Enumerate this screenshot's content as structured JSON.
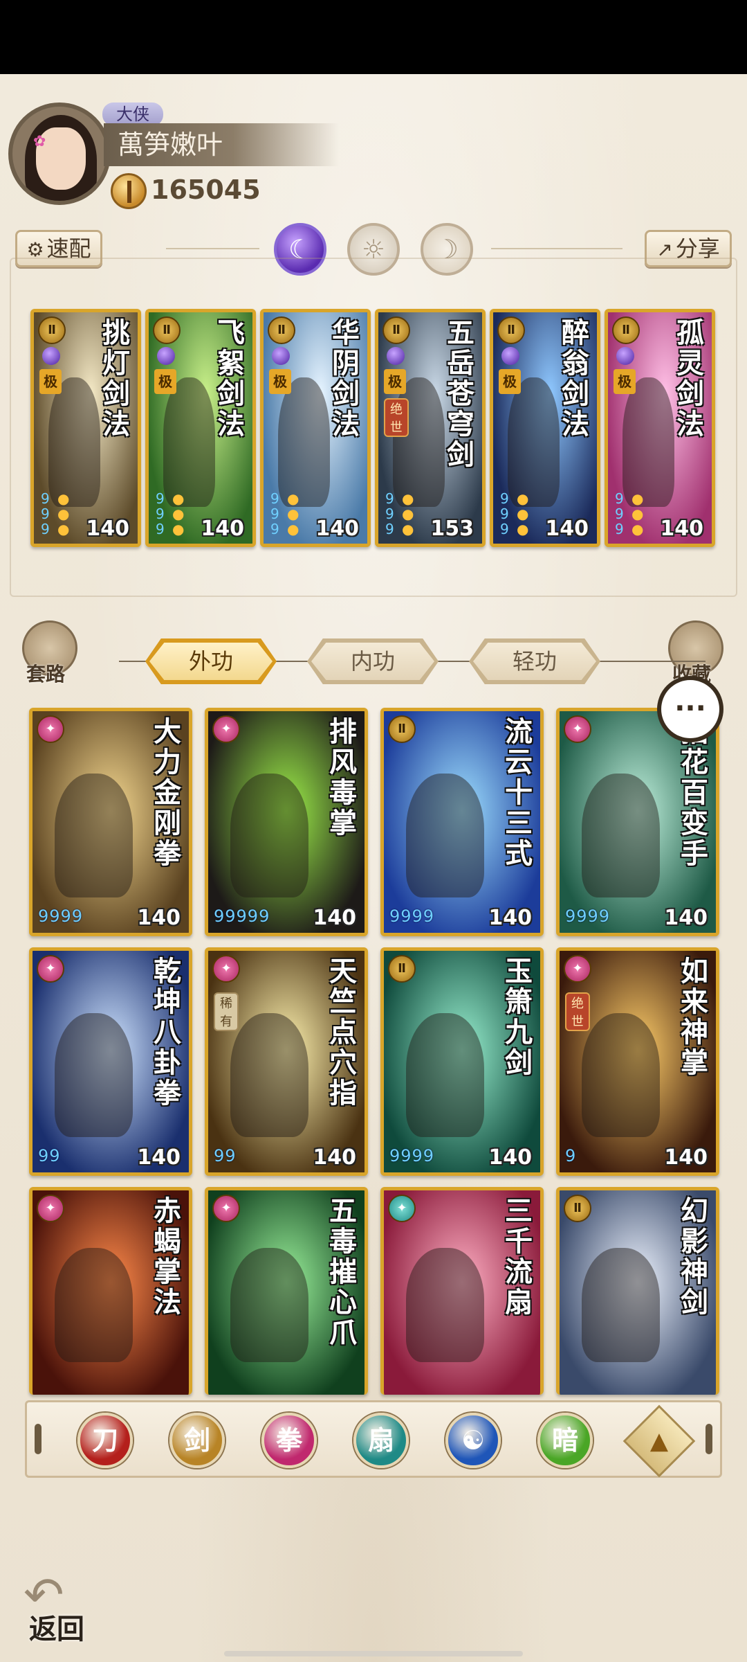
{
  "player": {
    "title": "大侠",
    "name": "萬笋嫩叶",
    "coins": "165045"
  },
  "toolbar": {
    "quick_config_label": "速配",
    "share_label": "分享",
    "gear_icon": "⚙",
    "share_icon": "↗"
  },
  "loadout": [
    {
      "title": "挑灯剑法",
      "tag": "极",
      "value": "140",
      "color_a": "#f4e9c6",
      "color_b": "#5d4b2a"
    },
    {
      "title": "飞絮剑法",
      "tag": "极",
      "value": "140",
      "color_a": "#c9f08a",
      "color_b": "#2f6a24"
    },
    {
      "title": "华阴剑法",
      "tag": "极",
      "value": "140",
      "color_a": "#e6f4ff",
      "color_b": "#4a7aa8"
    },
    {
      "title": "五岳苍穹剑",
      "tag": "极",
      "tag2": "绝世",
      "value": "153",
      "color_a": "#c9d8e6",
      "color_b": "#2c3a4a"
    },
    {
      "title": "醉翁剑法",
      "tag": "极",
      "value": "140",
      "color_a": "#8fc8ff",
      "color_b": "#1b2a5a"
    },
    {
      "title": "孤灵剑法",
      "tag": "极",
      "value": "140",
      "color_a": "#ffc0e6",
      "color_b": "#a0306e"
    }
  ],
  "tabs": {
    "left_label": "套路",
    "right_label": "收藏",
    "items": [
      "外功",
      "内功",
      "轻功"
    ],
    "active_index": 0
  },
  "skills": [
    {
      "title": "大力金刚拳",
      "pips": "9999",
      "value": "140",
      "rank": "pink",
      "color_a": "#f5d890",
      "color_b": "#5a4220"
    },
    {
      "title": "排风毒掌",
      "pips": "99999",
      "value": "140",
      "rank": "pink",
      "color_a": "#9ef04a",
      "color_b": "#1d1a18"
    },
    {
      "title": "流云十三式",
      "pips": "9999",
      "value": "140",
      "rank": "gold",
      "color_a": "#9fe0ff",
      "color_b": "#1c3c9a"
    },
    {
      "title": "拈花百变手",
      "pips": "9999",
      "value": "140",
      "rank": "pink",
      "color_a": "#bff0dc",
      "color_b": "#1e5a46"
    },
    {
      "title": "乾坤八卦拳",
      "pips": "99",
      "value": "140",
      "rank": "pink",
      "color_a": "#cfe4ff",
      "color_b": "#1a2f6e"
    },
    {
      "title": "天竺点穴指",
      "pips": "99",
      "value": "140",
      "rank": "pink",
      "tag3": "稀有",
      "color_a": "#fff3b0",
      "color_b": "#4a3212"
    },
    {
      "title": "玉箫九剑",
      "pips": "9999",
      "value": "140",
      "rank": "gold",
      "color_a": "#9af0d0",
      "color_b": "#0f4a3c"
    },
    {
      "title": "如来神掌",
      "pips": "9",
      "value": "140",
      "rank": "pink",
      "tag2": "绝世",
      "color_a": "#ffce6a",
      "color_b": "#3a1a0c"
    },
    {
      "title": "赤蝎掌法",
      "pips": "",
      "value": "",
      "rank": "pink",
      "color_a": "#ff8a4a",
      "color_b": "#4a120a"
    },
    {
      "title": "五毒摧心爪",
      "pips": "",
      "value": "",
      "rank": "pink",
      "color_a": "#9af09a",
      "color_b": "#10401e"
    },
    {
      "title": "三千流扇",
      "pips": "",
      "value": "",
      "rank": "teal",
      "color_a": "#ffb0c4",
      "color_b": "#8a1a3a"
    },
    {
      "title": "幻影神剑",
      "pips": "",
      "value": "",
      "rank": "gold",
      "color_a": "#eef4ff",
      "color_b": "#3a4a6a"
    }
  ],
  "filters": [
    {
      "name": "blade",
      "glyph": "刀",
      "color": "#b4201c"
    },
    {
      "name": "sword",
      "glyph": "剑",
      "color": "#b88426"
    },
    {
      "name": "fist",
      "glyph": "拳",
      "color": "#c0286e"
    },
    {
      "name": "fan",
      "glyph": "扇",
      "color": "#1f8a86"
    },
    {
      "name": "yin-yang",
      "glyph": "☯",
      "color": "#1f56b8"
    },
    {
      "name": "hidden",
      "glyph": "暗",
      "color": "#4aa626"
    }
  ],
  "filter_up_glyph": "▲",
  "chat_glyph": "···",
  "back_label": "返回",
  "back_arrow": "↶"
}
